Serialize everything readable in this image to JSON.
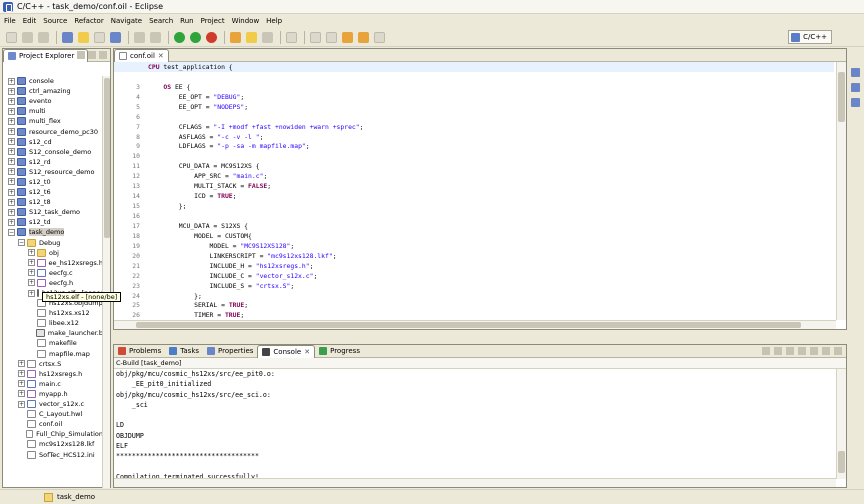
{
  "window": {
    "title": "C/C++ - task_demo/conf.oil - Eclipse"
  },
  "menu": [
    "File",
    "Edit",
    "Source",
    "Refactor",
    "Navigate",
    "Search",
    "Run",
    "Project",
    "Window",
    "Help"
  ],
  "perspective": {
    "label": "C/C++"
  },
  "explorer": {
    "tab_label": "Project Explorer",
    "items": [
      {
        "label": "console",
        "level": 0,
        "exp": "+",
        "icon": "project"
      },
      {
        "label": "ctrl_amazing",
        "level": 0,
        "exp": "+",
        "icon": "project"
      },
      {
        "label": "evento",
        "level": 0,
        "exp": "+",
        "icon": "project"
      },
      {
        "label": "multi",
        "level": 0,
        "exp": "+",
        "icon": "project"
      },
      {
        "label": "multi_flex",
        "level": 0,
        "exp": "+",
        "icon": "project"
      },
      {
        "label": "resource_demo_pc30",
        "level": 0,
        "exp": "+",
        "icon": "project"
      },
      {
        "label": "s12_cd",
        "level": 0,
        "exp": "+",
        "icon": "project"
      },
      {
        "label": "S12_console_demo",
        "level": 0,
        "exp": "+",
        "icon": "project"
      },
      {
        "label": "s12_rd",
        "level": 0,
        "exp": "+",
        "icon": "project"
      },
      {
        "label": "S12_resource_demo",
        "level": 0,
        "exp": "+",
        "icon": "project"
      },
      {
        "label": "s12_t0",
        "level": 0,
        "exp": "+",
        "icon": "project"
      },
      {
        "label": "s12_t6",
        "level": 0,
        "exp": "+",
        "icon": "project"
      },
      {
        "label": "s12_t8",
        "level": 0,
        "exp": "+",
        "icon": "project"
      },
      {
        "label": "S12_task_demo",
        "level": 0,
        "exp": "+",
        "icon": "project"
      },
      {
        "label": "s12_td",
        "level": 0,
        "exp": "+",
        "icon": "project"
      },
      {
        "label": "task_demo",
        "level": 0,
        "exp": "-",
        "icon": "project",
        "selected": true
      },
      {
        "label": "Debug",
        "level": 1,
        "exp": "-",
        "icon": "folder"
      },
      {
        "label": "obj",
        "level": 2,
        "exp": "+",
        "icon": "folder"
      },
      {
        "label": "ee_hs12xsregs.h",
        "level": 2,
        "exp": "+",
        "icon": "hfile"
      },
      {
        "label": "eecfg.c",
        "level": 2,
        "exp": "+",
        "icon": "cfile"
      },
      {
        "label": "eecfg.h",
        "level": 2,
        "exp": "+",
        "icon": "hfile"
      },
      {
        "label": "hs12xs.elf - [none/be]",
        "level": 2,
        "exp": "+",
        "icon": "exe"
      },
      {
        "label": "hs12xs.objdump",
        "level": 2,
        "exp": "",
        "icon": "file"
      },
      {
        "label": "hs12xs.xs12",
        "level": 2,
        "exp": "",
        "icon": "file"
      },
      {
        "label": "libee.x12",
        "level": 2,
        "exp": "",
        "icon": "file"
      },
      {
        "label": "make_launcher.b",
        "level": 2,
        "exp": "",
        "icon": "exe"
      },
      {
        "label": "makefile",
        "level": 2,
        "exp": "",
        "icon": "file"
      },
      {
        "label": "mapfile.map",
        "level": 2,
        "exp": "",
        "icon": "file"
      },
      {
        "label": "crtsx.S",
        "level": 1,
        "exp": "+",
        "icon": "file"
      },
      {
        "label": "hs12xsregs.h",
        "level": 1,
        "exp": "+",
        "icon": "hfile"
      },
      {
        "label": "main.c",
        "level": 1,
        "exp": "+",
        "icon": "cfile"
      },
      {
        "label": "myapp.h",
        "level": 1,
        "exp": "+",
        "icon": "hfile"
      },
      {
        "label": "vector_s12x.c",
        "level": 1,
        "exp": "+",
        "icon": "cfile"
      },
      {
        "label": "C_Layout.hwl",
        "level": 1,
        "exp": "",
        "icon": "file"
      },
      {
        "label": "conf.oil",
        "level": 1,
        "exp": "",
        "icon": "file"
      },
      {
        "label": "Full_Chip_Simulation",
        "level": 1,
        "exp": "",
        "icon": "file"
      },
      {
        "label": "mc9s12xs128.lkf",
        "level": 1,
        "exp": "",
        "icon": "file"
      },
      {
        "label": "SofTec_HCS12.ini",
        "level": 1,
        "exp": "",
        "icon": "file"
      }
    ],
    "tooltip": "hs12xs.elf - [none/be]"
  },
  "editor": {
    "tab_label": "conf.oil",
    "lines": [
      {
        "n": "",
        "text": "CPU test_application {"
      },
      {
        "n": "",
        "text": ""
      },
      {
        "n": "3",
        "text": "    OS EE {"
      },
      {
        "n": "4",
        "text": "        EE_OPT = \"DEBUG\";"
      },
      {
        "n": "5",
        "text": "        EE_OPT = \"NODEPS\";"
      },
      {
        "n": "6",
        "text": ""
      },
      {
        "n": "7",
        "text": "        CFLAGS = \"-I +modf +fast +nowiden +warn +sprec\";"
      },
      {
        "n": "8",
        "text": "        ASFLAGS = \"-c -v -l \";"
      },
      {
        "n": "9",
        "text": "        LDFLAGS = \"-p -sa -m mapfile.map\";"
      },
      {
        "n": "10",
        "text": ""
      },
      {
        "n": "11",
        "text": "        CPU_DATA = MC9S12XS {"
      },
      {
        "n": "12",
        "text": "            APP_SRC = \"main.c\";"
      },
      {
        "n": "13",
        "text": "            MULTI_STACK = FALSE;"
      },
      {
        "n": "14",
        "text": "            ICD = TRUE;"
      },
      {
        "n": "15",
        "text": "        };"
      },
      {
        "n": "16",
        "text": ""
      },
      {
        "n": "17",
        "text": "        MCU_DATA = S12XS {"
      },
      {
        "n": "18",
        "text": "            MODEL = CUSTOM{"
      },
      {
        "n": "19",
        "text": "                MODEL = \"MC9S12XS128\";"
      },
      {
        "n": "20",
        "text": "                LINKERSCRIPT = \"mc9s12xs128.lkf\";"
      },
      {
        "n": "21",
        "text": "                INCLUDE_H = \"hs12xsregs.h\";"
      },
      {
        "n": "22",
        "text": "                INCLUDE_C = \"vector_s12x.c\";"
      },
      {
        "n": "23",
        "text": "                INCLUDE_S = \"crtsx.S\";"
      },
      {
        "n": "24",
        "text": "            };"
      },
      {
        "n": "25",
        "text": "            SERIAL = TRUE;"
      },
      {
        "n": "26",
        "text": "            TIMER = TRUE;"
      }
    ]
  },
  "bottom_tabs": [
    {
      "label": "Problems",
      "active": false
    },
    {
      "label": "Tasks",
      "active": false
    },
    {
      "label": "Properties",
      "active": false
    },
    {
      "label": "Console",
      "active": true
    },
    {
      "label": "Progress",
      "active": false
    }
  ],
  "console": {
    "subtitle": "C-Build [task_demo]",
    "lines": [
      "obj/pkg/mcu/cosmic_hs12xs/src/ee_pit0.o:",
      "    _EE_pit0_initialized",
      "obj/pkg/mcu/cosmic_hs12xs/src/ee_sci.o:",
      "    _sci",
      "",
      "LD",
      "OBJDUMP",
      "ELF",
      "************************************",
      "",
      "Compilation terminated successfully!"
    ]
  },
  "status": {
    "label": "task_demo"
  },
  "colors": {
    "window_bg": "#ece9d8",
    "current_line": "#e8f2fe",
    "keyword": "#7f0055",
    "string": "#2a00ff"
  }
}
